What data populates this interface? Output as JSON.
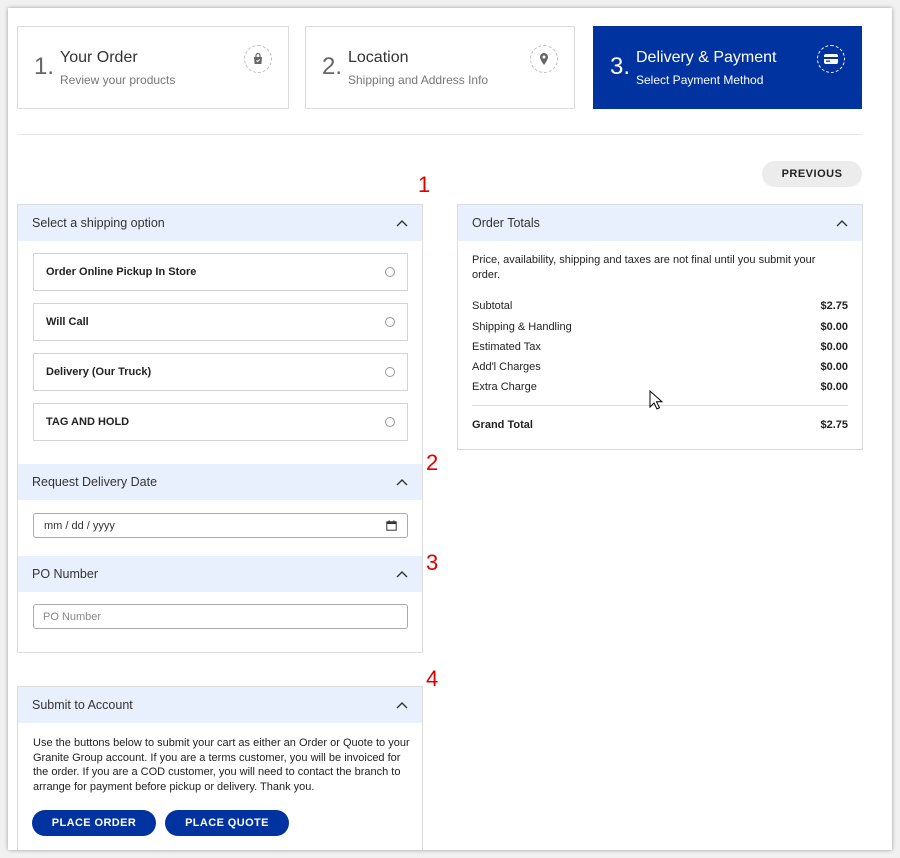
{
  "steps": [
    {
      "num": "1.",
      "title": "Your Order",
      "subtitle": "Review your products",
      "icon": "shopping-bag-icon"
    },
    {
      "num": "2.",
      "title": "Location",
      "subtitle": "Shipping and Address Info",
      "icon": "map-pin-icon"
    },
    {
      "num": "3.",
      "title": "Delivery & Payment",
      "subtitle": "Select Payment Method",
      "icon": "credit-card-icon"
    }
  ],
  "previous_label": "PREVIOUS",
  "annotations": [
    "1",
    "2",
    "3",
    "4"
  ],
  "shipping": {
    "title": "Select a shipping option",
    "options": [
      "Order Online Pickup In Store",
      "Will Call",
      "Delivery (Our Truck)",
      "TAG AND HOLD"
    ]
  },
  "delivery_date": {
    "title": "Request Delivery Date",
    "placeholder": "mm / dd / yyyy"
  },
  "po": {
    "title": "PO Number",
    "placeholder": "PO Number"
  },
  "submit": {
    "title": "Submit to Account",
    "text": "Use the buttons below to submit your cart as either an Order or Quote to your Granite Group account. If you are a terms customer, you will be invoiced for the order. If you are a COD customer, you will need to contact the branch to arrange for payment before pickup or delivery. Thank you.",
    "order_label": "PLACE ORDER",
    "quote_label": "PLACE QUOTE"
  },
  "totals": {
    "title": "Order Totals",
    "notice": "Price, availability, shipping and taxes are not final until you submit your order.",
    "rows": [
      {
        "label": "Subtotal",
        "value": "$2.75"
      },
      {
        "label": "Shipping & Handling",
        "value": "$0.00"
      },
      {
        "label": "Estimated Tax",
        "value": "$0.00"
      },
      {
        "label": "Add'l Charges",
        "value": "$0.00"
      },
      {
        "label": "Extra Charge",
        "value": "$0.00"
      }
    ],
    "grand_label": "Grand Total",
    "grand_value": "$2.75"
  },
  "colors": {
    "brand": "#0033a0",
    "panel_header": "#e8f0fd",
    "annotation": "#e00000"
  }
}
